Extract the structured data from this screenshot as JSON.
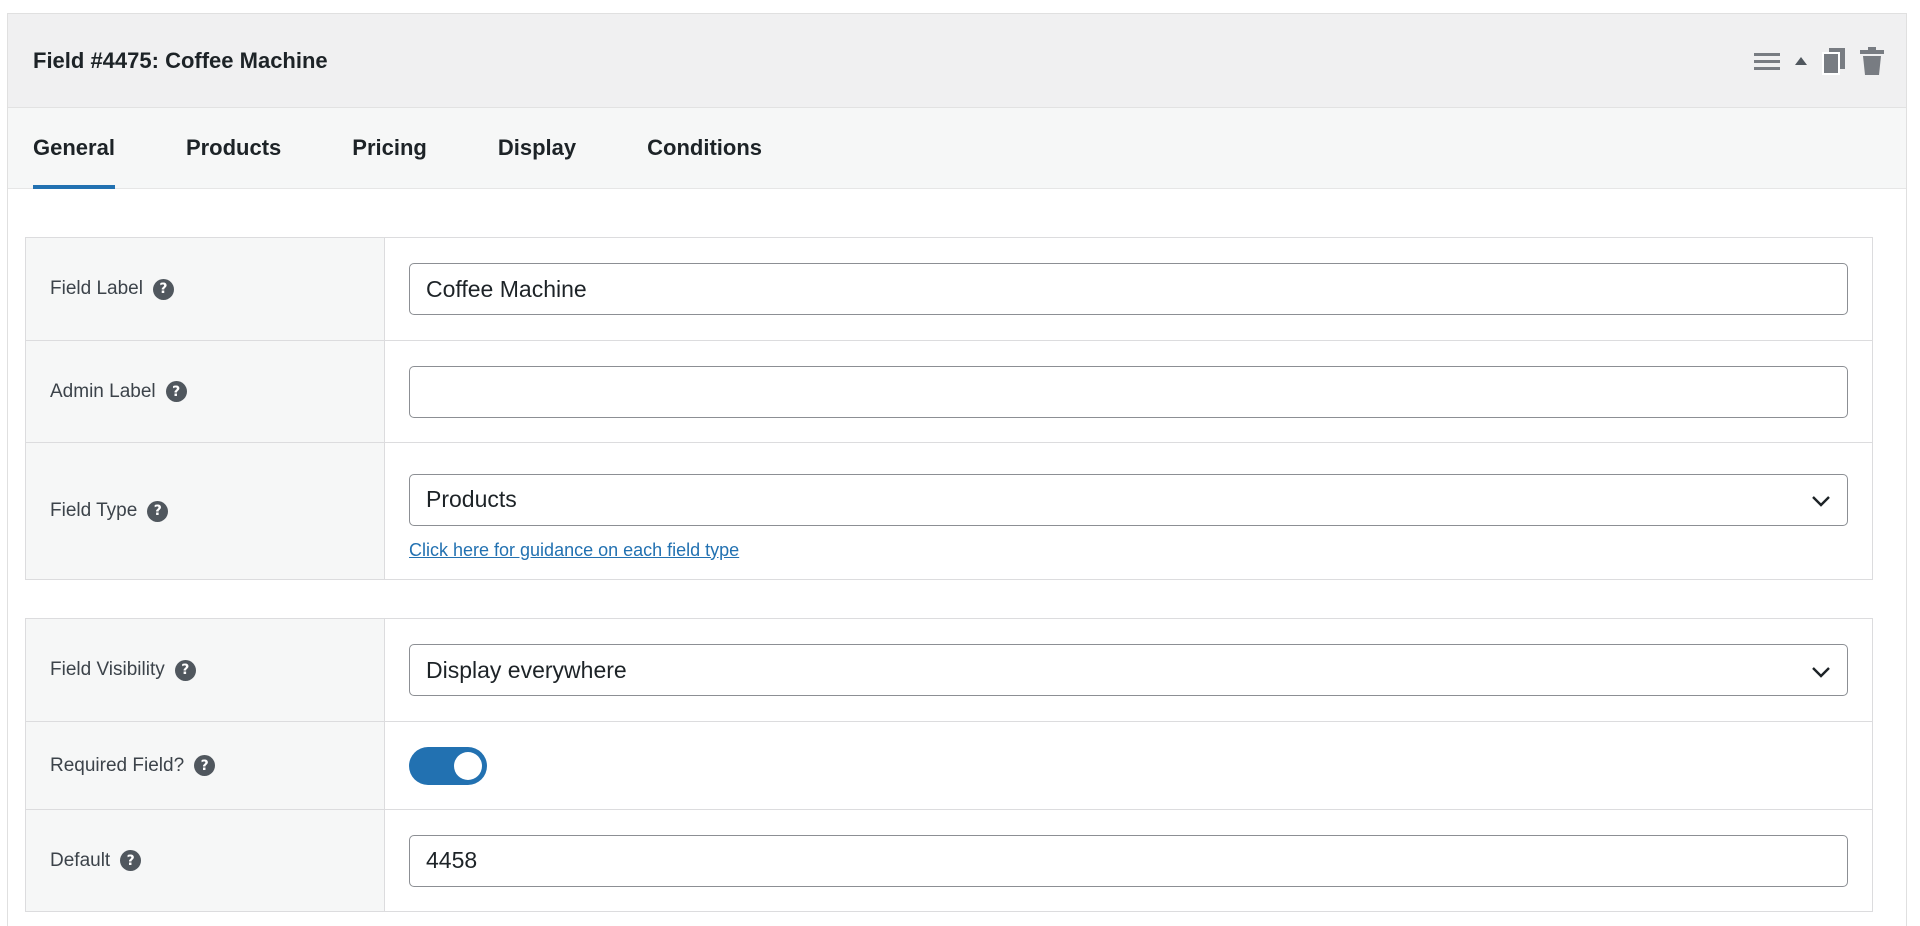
{
  "header": {
    "title": "Field #4475: Coffee Machine",
    "actions": [
      "menu-icon",
      "collapse-arrow-icon",
      "duplicate-icon",
      "trash-icon"
    ]
  },
  "tabs": [
    {
      "label": "General",
      "active": true
    },
    {
      "label": "Products",
      "active": false
    },
    {
      "label": "Pricing",
      "active": false
    },
    {
      "label": "Display",
      "active": false
    },
    {
      "label": "Conditions",
      "active": false
    }
  ],
  "general": {
    "field_label": {
      "label": "Field Label",
      "value": "Coffee Machine"
    },
    "admin_label": {
      "label": "Admin Label",
      "value": ""
    },
    "field_type": {
      "label": "Field Type",
      "value": "Products",
      "guide_link": "Click here for guidance on each field type"
    }
  },
  "visibility": {
    "field_visibility": {
      "label": "Field Visibility",
      "value": "Display everywhere"
    },
    "required": {
      "label": "Required Field?",
      "on": true
    },
    "default": {
      "label": "Default",
      "value": "4458"
    }
  },
  "help_glyph": "?",
  "colors": {
    "accent": "#2271b1",
    "header_bg": "#f0f0f1",
    "label_bg": "#f6f7f7",
    "border": "#dcdcde"
  }
}
